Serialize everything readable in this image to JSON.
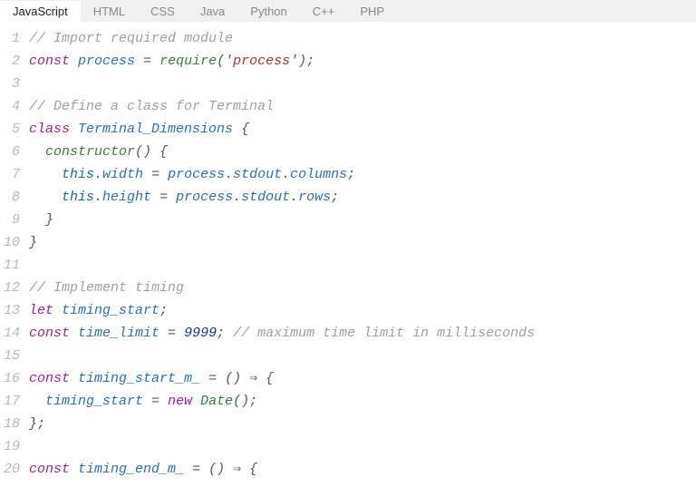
{
  "tabs": {
    "items": [
      "JavaScript",
      "HTML",
      "CSS",
      "Java",
      "Python",
      "C++",
      "PHP"
    ],
    "active_index": 0
  },
  "gutter": [
    "1",
    "2",
    "3",
    "4",
    "5",
    "6",
    "7",
    "8",
    "9",
    "10",
    "11",
    "12",
    "13",
    "14",
    "15",
    "16",
    "17",
    "18",
    "19",
    "20"
  ],
  "code": {
    "l1_comment": "// Import required module",
    "l2": {
      "kw": "const",
      "id": "process",
      "eq": " = ",
      "fn": "require",
      "op": "(",
      "str": "'process'",
      "cp": ");"
    },
    "l4_comment": "// Define a class for Terminal",
    "l5": {
      "kw": "class",
      "id": "Terminal_Dimensions",
      "brace": " {"
    },
    "l6": {
      "indent": "  ",
      "fn": "constructor",
      "rest": "() {"
    },
    "l7": {
      "indent": "    ",
      "this": "this",
      "dot1": ".",
      "prop": "width",
      "eq": " = ",
      "obj": "process",
      "dot2": ".",
      "p2": "stdout",
      "dot3": ".",
      "p3": "columns",
      "semi": ";"
    },
    "l8": {
      "indent": "    ",
      "this": "this",
      "dot1": ".",
      "prop": "height",
      "eq": " = ",
      "obj": "process",
      "dot2": ".",
      "p2": "stdout",
      "dot3": ".",
      "p3": "rows",
      "semi": ";"
    },
    "l9": "  }",
    "l10": "}",
    "l12_comment": "// Implement timing",
    "l13": {
      "kw": "let",
      "id": "timing_start",
      "semi": ";"
    },
    "l14": {
      "kw": "const",
      "id": "time_limit",
      "eq": " = ",
      "num": "9999",
      "semi": "; ",
      "comment": "// maximum time limit in milliseconds"
    },
    "l16": {
      "kw": "const",
      "id": "timing_start_m_",
      "eq": " = () ",
      "arrow": "⇒",
      "brace": " {"
    },
    "l17": {
      "indent": "  ",
      "id": "timing_start",
      "eq": " = ",
      "kw": "new",
      "sp": " ",
      "fn": "Date",
      "rest": "();"
    },
    "l18": "};",
    "l20": {
      "kw": "const",
      "id": "timing_end_m_",
      "eq": " = () ",
      "arrow": "⇒",
      "brace": " {"
    }
  }
}
